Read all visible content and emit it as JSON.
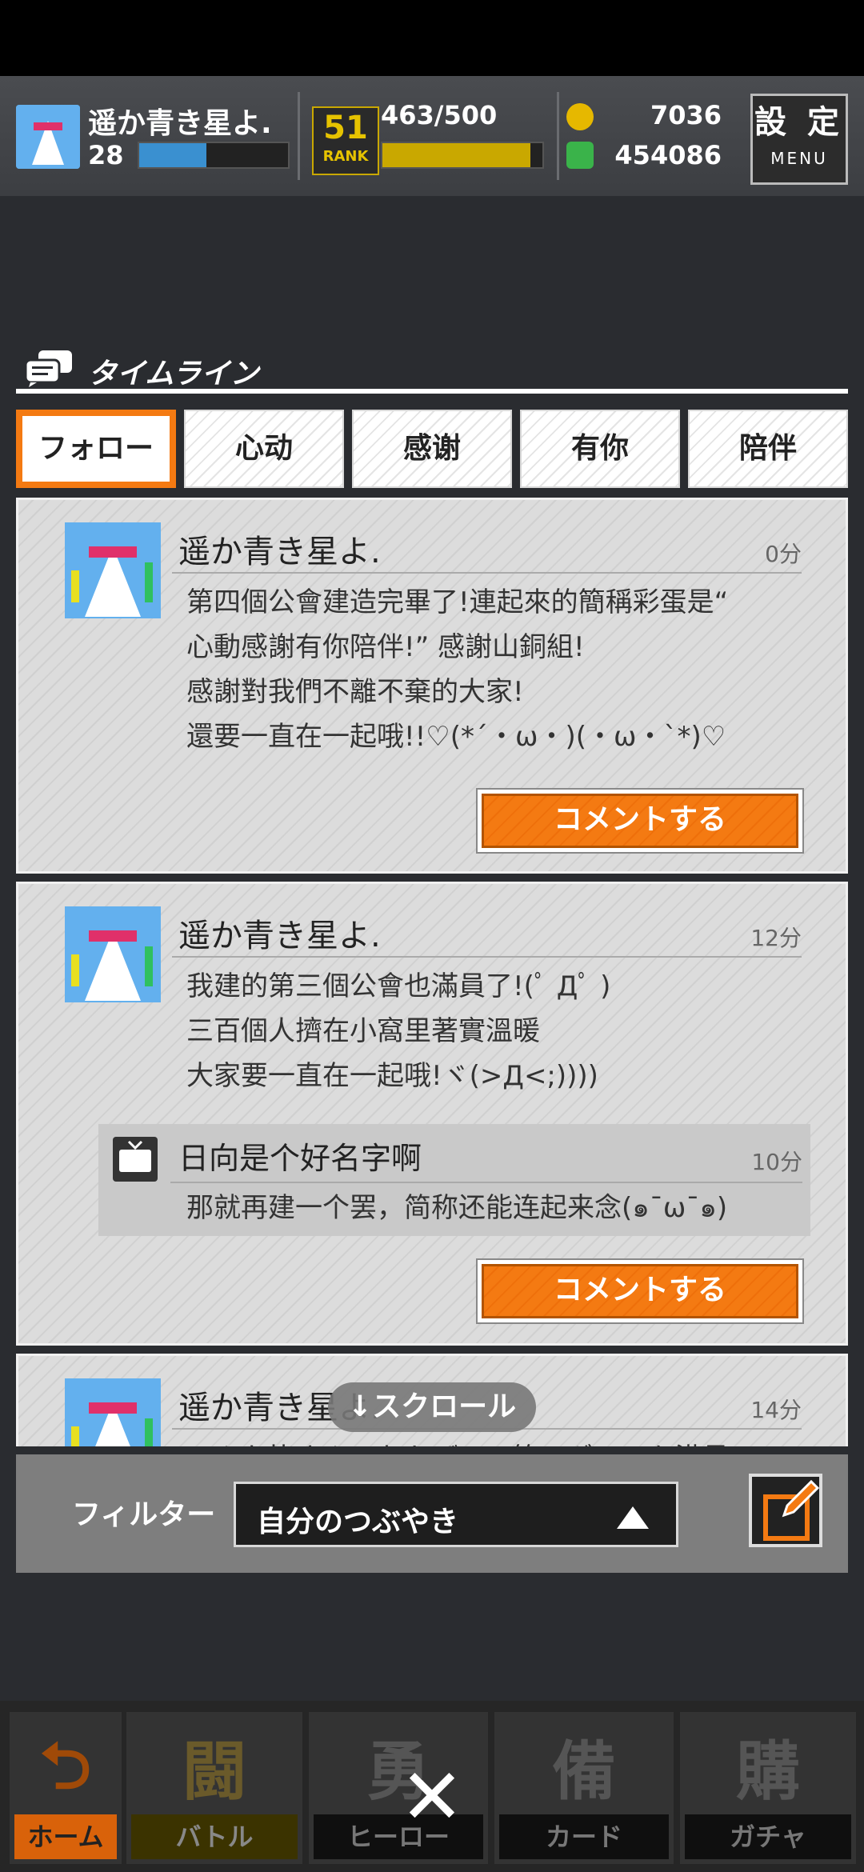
{
  "header": {
    "player_name": "遥か青き星よ.",
    "level": "28",
    "level_fill": 0.45,
    "rank_number": "51",
    "rank_label": "RANK",
    "rank_progress": "463/500",
    "rank_fill": 0.926,
    "gold": "7036",
    "gems": "454086",
    "settings_label": "設 定",
    "settings_sub": "MENU"
  },
  "timeline": {
    "title": "タイムライン",
    "tabs": [
      "フォロー",
      "心动",
      "感谢",
      "有你",
      "陪伴"
    ],
    "active_tab": 0
  },
  "posts": [
    {
      "name": "遥か青き星よ.",
      "time": "0分",
      "lines": [
        "第四個公會建造完畢了!連起來的簡稱彩蛋是“",
        "心動感謝有你陪伴!” 感謝山銅組!",
        "感謝對我們不離不棄的大家!",
        "還要一直在一起哦!!♡(*´・ω・)(・ω・`*)♡"
      ],
      "comment_label": "コメントする"
    },
    {
      "name": "遥か青き星よ.",
      "time": "12分",
      "lines": [
        "我建的第三個公會也滿員了!(ﾟ Дﾟ )",
        "三百個人擠在小窩里著實溫暖",
        "大家要一直在一起哦!ヾ(>Д<;))))"
      ],
      "reply": {
        "name": "日向是个好名字啊",
        "time": "10分",
        "text": "那就再建一个罢，简称还能连起来念(๑¯ω¯๑)"
      },
      "comment_label": "コメントする"
    },
    {
      "name": "遥か青き星よ.",
      "time": "14分",
      "lines": [
        "みんな皆さんのおかげで、第三ギルドも満員"
      ]
    }
  ],
  "scroll_hint": "↓スクロール",
  "filter": {
    "label": "フィルター",
    "value": "自分のつぶやき"
  },
  "bottom_nav": [
    {
      "glyph": "⮌",
      "label": "ホーム"
    },
    {
      "glyph": "闘",
      "label": "バトル"
    },
    {
      "glyph": "勇",
      "label": "ヒーロー"
    },
    {
      "glyph": "備",
      "label": "カード"
    },
    {
      "glyph": "購",
      "label": "ガチャ"
    }
  ],
  "close_glyph": "✕",
  "colors": {
    "accent": "#f47a12",
    "background": "#2a2c30"
  }
}
